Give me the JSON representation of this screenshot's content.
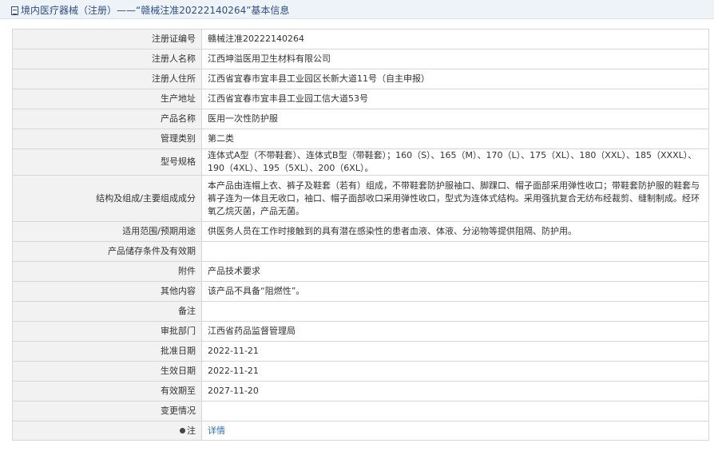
{
  "header": {
    "title_prefix": "境内医疗器械（注册）",
    "dash": "——",
    "title_main": "“赣械注准20222140264”基本信息"
  },
  "rows": [
    {
      "label": "注册证编号",
      "value": "赣械注准20222140264"
    },
    {
      "label": "注册人名称",
      "value": "江西坤溢医用卫生材料有限公司"
    },
    {
      "label": "注册人住所",
      "value": "江西省宜春市宜丰县工业园区长新大道11号（自主申报）"
    },
    {
      "label": "生产地址",
      "value": "江西省宜春市宜丰县工业园工信大道53号"
    },
    {
      "label": "产品名称",
      "value": "医用一次性防护服"
    },
    {
      "label": "管理类别",
      "value": "第二类"
    },
    {
      "label": "型号规格",
      "value": "连体式A型（不带鞋套）、连体式B型（带鞋套）；160（S）、165（M）、170（L）、175（XL）、180（XXL）、185（XXXL）、190（4XL）、195（5XL）、200（6XL）。"
    },
    {
      "label": "结构及组成/主要组成成分",
      "value": "本产品由连帽上衣、裤子及鞋套（若有）组成，不带鞋套防护服袖口、脚踝口、帽子面部采用弹性收口；带鞋套防护服的鞋套与裤子连为一体且无收口，袖口、帽子面部收口采用弹性收口，型式为连体式结构。采用强抗复合无纺布经裁剪、缝制制成。经环氧乙烷灭菌，产品无菌。"
    },
    {
      "label": "适用范围/预期用途",
      "value": "供医务人员在工作时接触到的具有潜在感染性的患者血液、体液、分泌物等提供阻隔、防护用。"
    },
    {
      "label": "产品储存条件及有效期",
      "value": ""
    },
    {
      "label": "附件",
      "value": "产品技术要求"
    },
    {
      "label": "其他内容",
      "value": "该产品不具备“阻燃性”。"
    },
    {
      "label": "备注",
      "value": ""
    },
    {
      "label": "审批部门",
      "value": "江西省药品监督管理局"
    },
    {
      "label": "批准日期",
      "value": "2022-11-21"
    },
    {
      "label": "生效日期",
      "value": "2022-11-21"
    },
    {
      "label": "有效期至",
      "value": "2027-11-20"
    },
    {
      "label": "变更情况",
      "value": ""
    }
  ],
  "note_row": {
    "label": "注",
    "link_text": "详情",
    "icon": "info-dot-icon"
  }
}
